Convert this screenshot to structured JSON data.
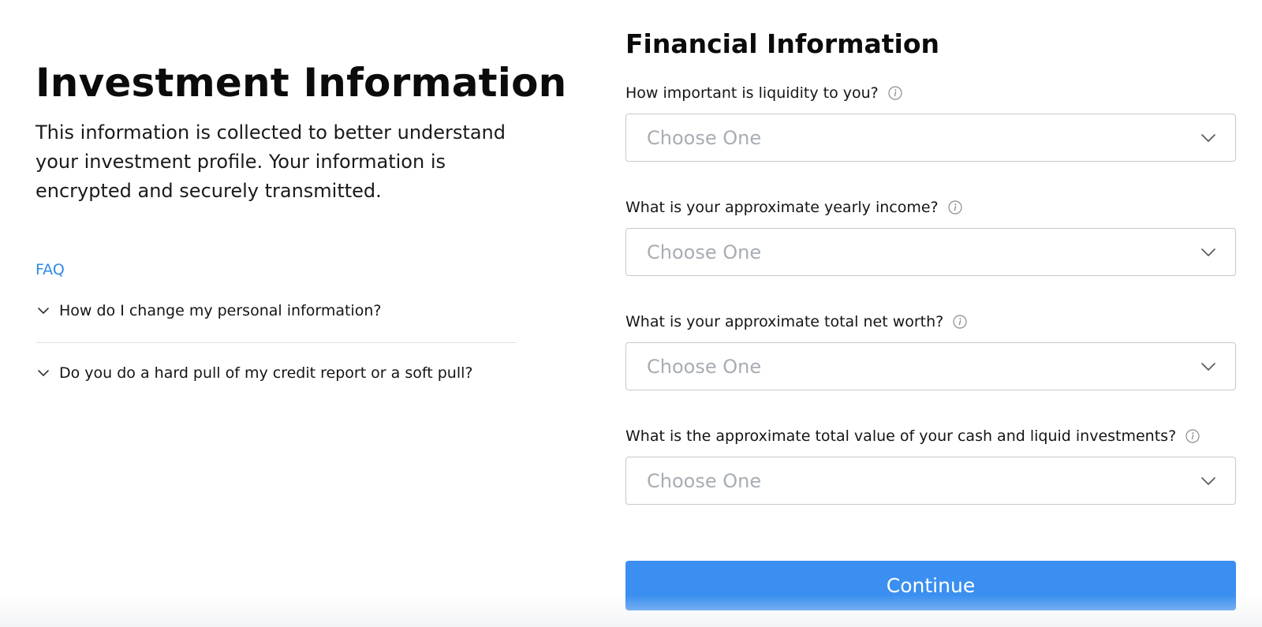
{
  "left": {
    "title": "Investment Information",
    "intro": "This information is collected to better understand your investment profile. Your information is encrypted and securely transmitted.",
    "faq": {
      "title": "FAQ",
      "items": [
        {
          "label": "How do I change my personal information?"
        },
        {
          "label": "Do you do a hard pull of my credit report or a soft pull?"
        }
      ]
    }
  },
  "right": {
    "title": "Financial Information",
    "fields": [
      {
        "label": "How important is liquidity to you?",
        "placeholder": "Choose One"
      },
      {
        "label": "What is your approximate yearly income?",
        "placeholder": "Choose One"
      },
      {
        "label": "What is your approximate total net worth?",
        "placeholder": "Choose One"
      },
      {
        "label": "What is the approximate total value of your cash and liquid investments?",
        "placeholder": "Choose One"
      }
    ],
    "continue_label": "Continue"
  },
  "colors": {
    "accent": "#3a8ff0",
    "link": "#2f8ae6",
    "placeholder": "#a8adb3",
    "border": "#c9c9c9"
  },
  "icons": {
    "faq_toggle": "chevron-down-icon",
    "field_info": "info-icon",
    "select_toggle": "chevron-down-icon"
  }
}
